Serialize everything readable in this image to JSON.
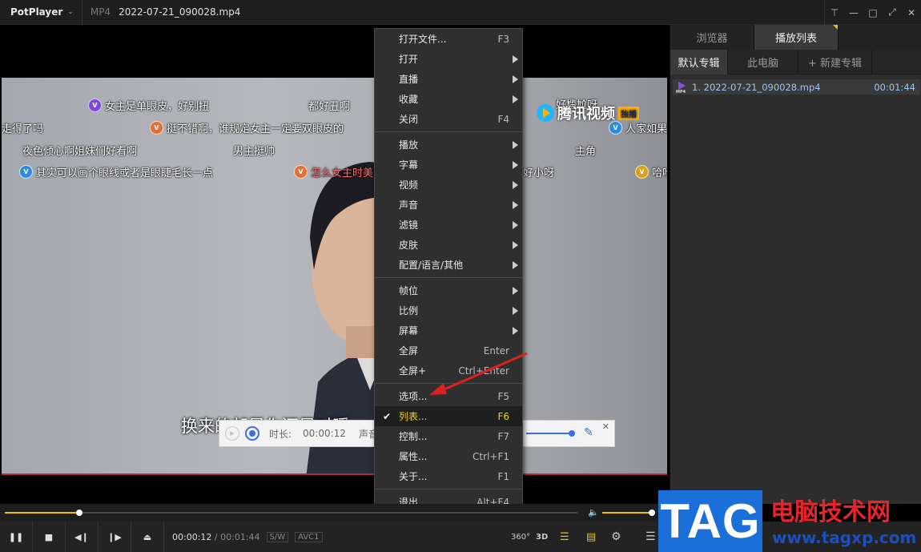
{
  "app": {
    "name": "PotPlayer",
    "format": "MP4",
    "filename": "2022-07-21_090028.mp4"
  },
  "window_buttons": [
    "pin-icon",
    "minimize-icon",
    "maximize-icon",
    "fullscreen-icon",
    "close-icon"
  ],
  "danmaku": [
    {
      "text": "女主是单眼皮，好别扭",
      "badge": "purple"
    },
    {
      "text": "都好丑啊",
      "badge": ""
    },
    {
      "text": "走得了吗",
      "badge": ""
    },
    {
      "text": "挺不错啊，谁规定女主一定要双眼皮的",
      "badge": "orange"
    },
    {
      "text": "夜色倾心啊姐妹们好看啊",
      "badge": ""
    },
    {
      "text": "男主挺帅",
      "badge": ""
    },
    {
      "text": "其实可以画个眼线或者是眼睫毛长一点",
      "badge": "blue"
    },
    {
      "text": "怎么女主时美",
      "badge": "orange"
    },
    {
      "text": "好尴尬呀",
      "badge": ""
    },
    {
      "text": "人家如果",
      "badge": "blue"
    },
    {
      "text": "主角",
      "badge": ""
    },
    {
      "text": "好小呀",
      "badge": ""
    },
    {
      "text": "哈哈",
      "badge": "gold"
    }
  ],
  "video_logo": {
    "text": "腾讯视频",
    "badge": "独播"
  },
  "subtitle": "换来的却是你还是对暖",
  "recorder": {
    "duration_label": "时长:",
    "duration_value": "00:00:12",
    "sound_label": "声音:"
  },
  "panel": {
    "tabs": [
      "浏览器",
      "播放列表"
    ],
    "active_tab": "播放列表",
    "subtabs": [
      "默认专辑",
      "此电脑",
      "+ 新建专辑"
    ],
    "playlist": [
      {
        "title": "1. 2022-07-21_090028.mp4",
        "duration": "00:01:44"
      }
    ]
  },
  "context_menu": {
    "items": [
      {
        "label": "打开文件...",
        "key": "F3",
        "submenu": false
      },
      {
        "label": "打开",
        "key": "",
        "submenu": true
      },
      {
        "label": "直播",
        "key": "",
        "submenu": true
      },
      {
        "label": "收藏",
        "key": "",
        "submenu": true
      },
      {
        "label": "关闭",
        "key": "F4",
        "submenu": false
      },
      {
        "label": "播放",
        "key": "",
        "submenu": true
      },
      {
        "label": "字幕",
        "key": "",
        "submenu": true
      },
      {
        "label": "视频",
        "key": "",
        "submenu": true
      },
      {
        "label": "声音",
        "key": "",
        "submenu": true
      },
      {
        "label": "滤镜",
        "key": "",
        "submenu": true
      },
      {
        "label": "皮肤",
        "key": "",
        "submenu": true
      },
      {
        "label": "配置/语言/其他",
        "key": "",
        "submenu": true
      },
      {
        "label": "帧位",
        "key": "",
        "submenu": true
      },
      {
        "label": "比例",
        "key": "",
        "submenu": true
      },
      {
        "label": "屏幕",
        "key": "",
        "submenu": true
      },
      {
        "label": "全屏",
        "key": "Enter",
        "submenu": false
      },
      {
        "label": "全屏+",
        "key": "Ctrl+Enter",
        "submenu": false
      },
      {
        "label": "选项...",
        "key": "F5",
        "submenu": false
      },
      {
        "label": "列表...",
        "key": "F6",
        "submenu": false,
        "checked": true,
        "highlighted": true
      },
      {
        "label": "控制...",
        "key": "F7",
        "submenu": false
      },
      {
        "label": "属性...",
        "key": "Ctrl+F1",
        "submenu": false
      },
      {
        "label": "关于...",
        "key": "F1",
        "submenu": false
      },
      {
        "label": "退出",
        "key": "Alt+F4",
        "submenu": false
      }
    ]
  },
  "playback": {
    "progress": 0.13,
    "volume": 1.0,
    "current_time": "00:00:12",
    "separator": "/",
    "total_time": "00:01:44",
    "tags": [
      "S/W",
      "AVC1"
    ],
    "right_buttons": [
      "360°",
      "3D"
    ]
  },
  "watermark": {
    "logo": "TAG",
    "title": "电脑技术网",
    "url": "www.tagxp.com"
  },
  "colors": {
    "accent": "#f0c000",
    "menu_highlight": "#f5d400",
    "playlist_text": "#9ec4f0",
    "arrow": "#e02020"
  }
}
